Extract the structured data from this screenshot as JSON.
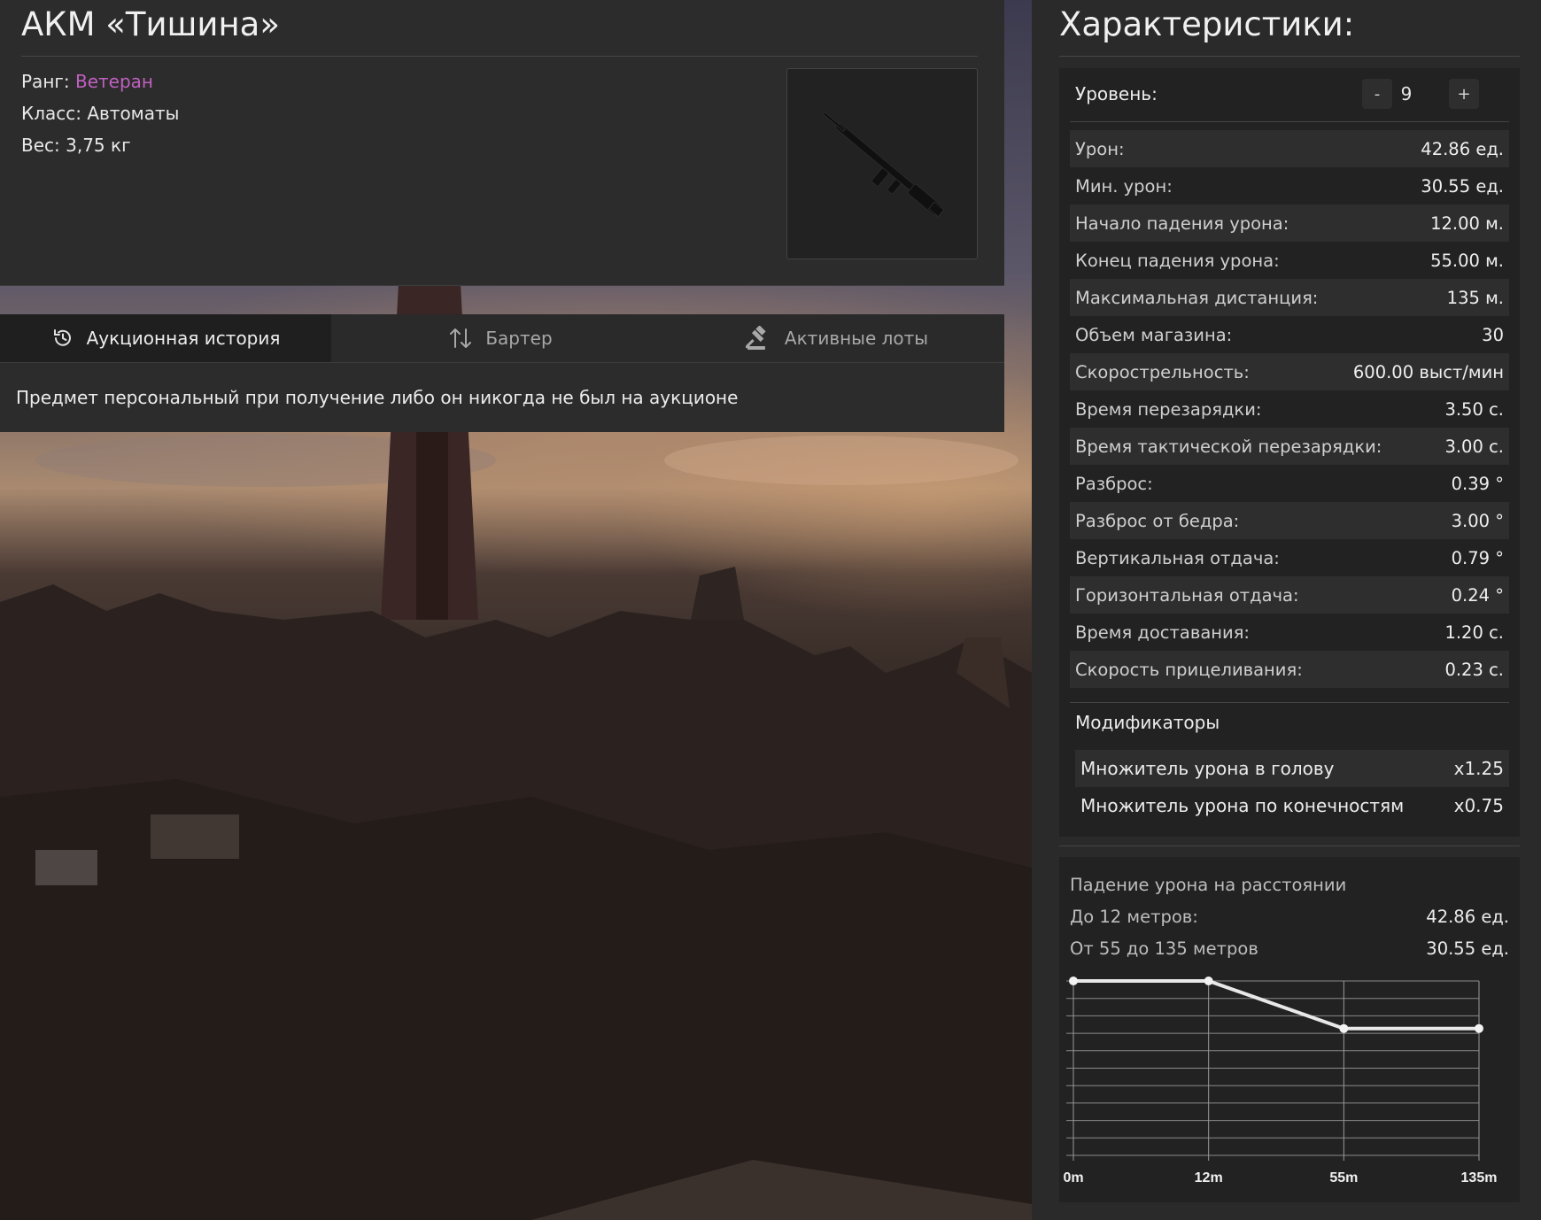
{
  "item": {
    "title": "АКМ «Тишина»",
    "rank_label": "Ранг:",
    "rank_value": "Ветеран",
    "rank_color": "#c060c0",
    "class_line": "Класс: Автоматы",
    "weight_line": "Вес: 3,75 кг",
    "image_icon": "rifle-icon"
  },
  "tabs": [
    {
      "label": "Аукционная история",
      "icon": "history-icon",
      "active": true
    },
    {
      "label": "Бартер",
      "icon": "swap-arrows-icon",
      "active": false
    },
    {
      "label": "Активные лоты",
      "icon": "gavel-icon",
      "active": false
    }
  ],
  "notice": "Предмет персональный при получение либо он никогда не был на аукционе",
  "characteristics": {
    "title": "Характеристики:",
    "level_label": "Уровень:",
    "level_minus": "-",
    "level_value": "9",
    "level_plus": "+",
    "stats": [
      {
        "key": "Урон:",
        "value": "42.86 ед."
      },
      {
        "key": "Мин. урон:",
        "value": "30.55 ед."
      },
      {
        "key": "Начало падения урона:",
        "value": "12.00 м."
      },
      {
        "key": "Конец падения урона:",
        "value": "55.00 м."
      },
      {
        "key": "Максимальная дистанция:",
        "value": "135 м."
      },
      {
        "key": "Объем магазина:",
        "value": "30"
      },
      {
        "key": "Скорострельность:",
        "value": "600.00 выст/мин"
      },
      {
        "key": "Время перезарядки:",
        "value": "3.50 с."
      },
      {
        "key": "Время тактической перезарядки:",
        "value": "3.00 с."
      },
      {
        "key": "Разброс:",
        "value": "0.39 °"
      },
      {
        "key": "Разброс от бедра:",
        "value": "3.00 °"
      },
      {
        "key": "Вертикальная отдача:",
        "value": "0.79 °"
      },
      {
        "key": "Горизонтальная отдача:",
        "value": "0.24 °"
      },
      {
        "key": "Время доставания:",
        "value": "1.20 с."
      },
      {
        "key": "Скорость прицеливания:",
        "value": "0.23 с."
      }
    ],
    "modifiers_title": "Модификаторы",
    "modifiers": [
      {
        "key": "Множитель урона в голову",
        "value": "x1.25"
      },
      {
        "key": "Множитель урона по конечностям",
        "value": "x0.75"
      }
    ]
  },
  "falloff": {
    "title": "Падение урона на расстоянии",
    "rows": [
      {
        "key": "До 12 метров:",
        "value": "42.86 ед."
      },
      {
        "key": "От 55 до 135 метров",
        "value": "30.55 ед."
      }
    ]
  },
  "chart_data": {
    "type": "line",
    "title": "",
    "xlabel": "",
    "ylabel": "",
    "categories": [
      "0m",
      "12m",
      "55m",
      "135m"
    ],
    "series": [
      {
        "values": [
          42.86,
          42.86,
          30.55,
          30.55
        ]
      }
    ],
    "ylim": [
      0,
      42.86
    ],
    "grid": true,
    "legend": "none"
  }
}
